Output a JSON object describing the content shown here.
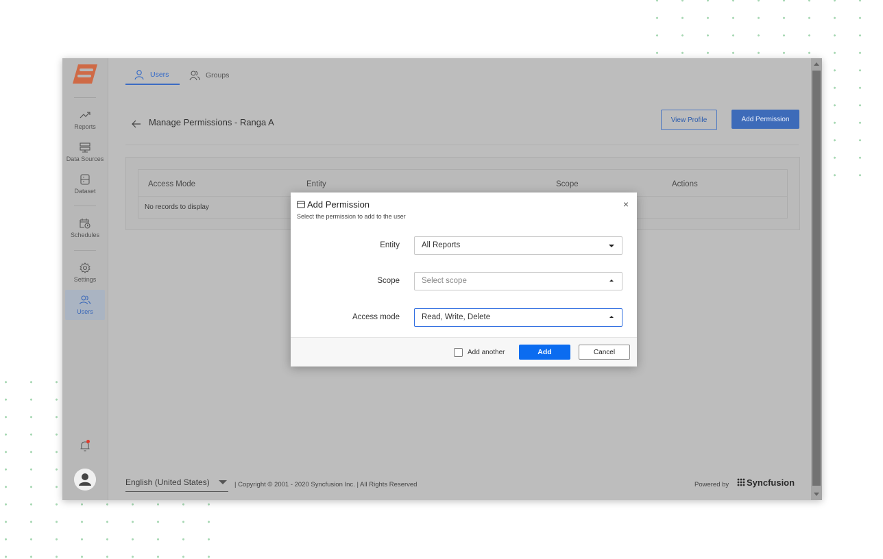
{
  "sidebar": {
    "items": [
      {
        "label": "Reports",
        "icon": "trend-line-icon"
      },
      {
        "label": "Data Sources",
        "icon": "data-source-icon"
      },
      {
        "label": "Dataset",
        "icon": "dataset-icon"
      },
      {
        "label": "Schedules",
        "icon": "calendar-clock-icon"
      },
      {
        "label": "Settings",
        "icon": "gear-icon"
      },
      {
        "label": "Users",
        "icon": "users-icon"
      }
    ],
    "active": "Users"
  },
  "tabs": [
    {
      "label": "Users",
      "icon": "user-icon"
    },
    {
      "label": "Groups",
      "icon": "group-icon"
    }
  ],
  "header": {
    "title": "Manage Permissions - Ranga A",
    "view_profile": "View Profile",
    "add_permission": "Add Permission"
  },
  "grid": {
    "columns": [
      "Access Mode",
      "Entity",
      "Scope",
      "Actions"
    ],
    "empty_text": "No records to display"
  },
  "modal": {
    "title": "Add Permission",
    "subtitle": "Select the permission to add to the user",
    "close": "×",
    "fields": [
      {
        "label": "Entity",
        "value": "All Reports"
      },
      {
        "label": "Scope",
        "placeholder": "Select scope"
      },
      {
        "label": "Access mode",
        "value": "Read, Write, Delete"
      }
    ],
    "add_another": "Add another",
    "add": "Add",
    "cancel": "Cancel"
  },
  "footer": {
    "language": "English (United States)",
    "copyright": "|  Copyright © 2001 - 2020 Syncfusion Inc.  |  All Rights Reserved",
    "powered_by": "Powered by",
    "brand": "Syncfusion"
  },
  "colors": {
    "accent": "#0b6cf0",
    "brand_orange": "#e0542e",
    "dots": "#a8d8b4"
  }
}
